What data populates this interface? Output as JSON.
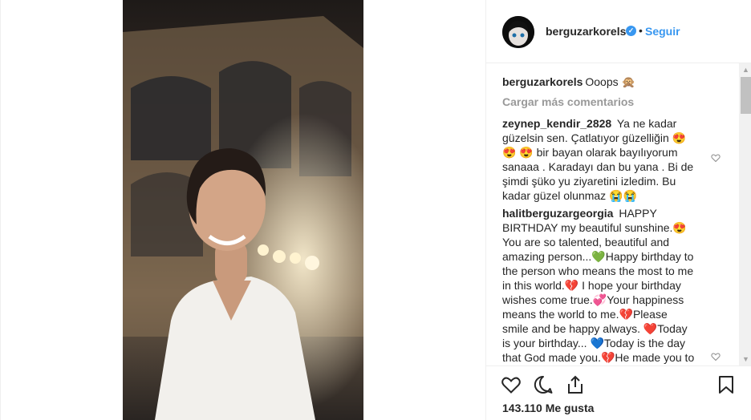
{
  "post": {
    "username": "berguzarkorels",
    "separator": "•",
    "follow_label": "Seguir",
    "verified_glyph": "✓"
  },
  "caption": {
    "username": "berguzarkorels",
    "text": "Ooops 🙊"
  },
  "load_more_label": "Cargar más comentarios",
  "comments": [
    {
      "username": "zeynep_kendir_2828",
      "text": "Ya ne kadar güzelsin sen. Çatlatıyor güzelliğin 😍😍 😍 bir bayan olarak bayılıyorum sanaaa . Karadayı dan bu yana . Bi de şimdi şüko yu ziyaretini izledim. Bu kadar güzel olunmaz 😭😭"
    },
    {
      "username": "halitberguzargeorgia",
      "text": "HAPPY BIRTHDAY my beautiful sunshine.😍 You are so talented, beautiful and amazing person...💚Happy birthday to the person who means the most to me in this world.💔 I hope your birthday wishes come true.💞Your happiness means the world to me.💔Please smile and be happy always. ❤️Today is your birthday... 💙Today is the day that God made you.💔He made you to be an"
    }
  ],
  "likes": "143.110 Me gusta",
  "icons": {
    "like": "heart-outline-icon",
    "comment": "comment-bubble-icon",
    "share": "share-arrow-icon",
    "save": "bookmark-icon"
  },
  "colors": {
    "accent": "#3897f0",
    "muted": "#999999",
    "text": "#262626"
  }
}
